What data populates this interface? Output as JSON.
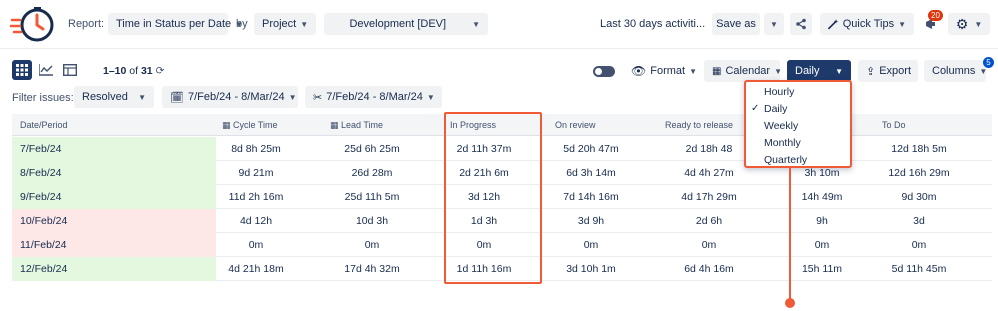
{
  "header": {
    "report_label": "Report:",
    "report_value": "Time in Status per Date",
    "by_label": "by",
    "group_value": "Project",
    "project_value": "Development [DEV]",
    "period_text": "Last 30 days activiti...",
    "save_as": "Save as",
    "quick_tips": "Quick Tips",
    "notification_count": "20"
  },
  "toolbar": {
    "pagination_range": "1–10",
    "pagination_of": "of",
    "pagination_total": "31",
    "format": "Format",
    "calendar": "Calendar",
    "interval": "Daily",
    "export": "Export",
    "columns": "Columns",
    "columns_badge": "5"
  },
  "filters": {
    "label": "Filter issues:",
    "status": "Resolved",
    "date_range_1": "7/Feb/24 - 8/Mar/24",
    "date_range_2": "7/Feb/24 - 8/Mar/24"
  },
  "interval_options": [
    "Hourly",
    "Daily",
    "Weekly",
    "Monthly",
    "Quarterly"
  ],
  "interval_selected": "Daily",
  "table": {
    "columns": [
      "Date/Period",
      "Cycle Time",
      "Lead Time",
      "In Progress",
      "On review",
      "Ready to release",
      "",
      "To Do"
    ],
    "rows": [
      {
        "date": "7/Feb/24",
        "tone": "green",
        "values": [
          "8d 8h 25m",
          "25d 6h 25m",
          "2d 11h 37m",
          "5d 20h 47m",
          "2d 18h 48",
          "",
          "12d 18h 5m"
        ]
      },
      {
        "date": "8/Feb/24",
        "tone": "green",
        "values": [
          "9d 21m",
          "26d 28m",
          "2d 21h 6m",
          "6d 3h 14m",
          "4d 4h 27m",
          "3h 10m",
          "12d 16h 29m"
        ]
      },
      {
        "date": "9/Feb/24",
        "tone": "green",
        "values": [
          "11d 2h 16m",
          "25d 11h 5m",
          "3d 12h",
          "7d 14h 16m",
          "4d 17h 29m",
          "14h 49m",
          "9d 30m"
        ]
      },
      {
        "date": "10/Feb/24",
        "tone": "red",
        "values": [
          "4d 12h",
          "10d 3h",
          "1d 3h",
          "3d 9h",
          "2d 6h",
          "9h",
          "3d"
        ]
      },
      {
        "date": "11/Feb/24",
        "tone": "red",
        "values": [
          "0m",
          "0m",
          "0m",
          "0m",
          "0m",
          "0m",
          "0m"
        ]
      },
      {
        "date": "12/Feb/24",
        "tone": "green",
        "values": [
          "4d 21h 18m",
          "17d 4h 32m",
          "1d 11h 16m",
          "3d 10h 1m",
          "6d 4h 16m",
          "15h 11m",
          "5d 11h 45m"
        ]
      }
    ]
  },
  "colors": {
    "accent": "#f05a36",
    "dark_button": "#1d3a6b",
    "good": "#e3f8df",
    "bad": "#fde7e7"
  }
}
